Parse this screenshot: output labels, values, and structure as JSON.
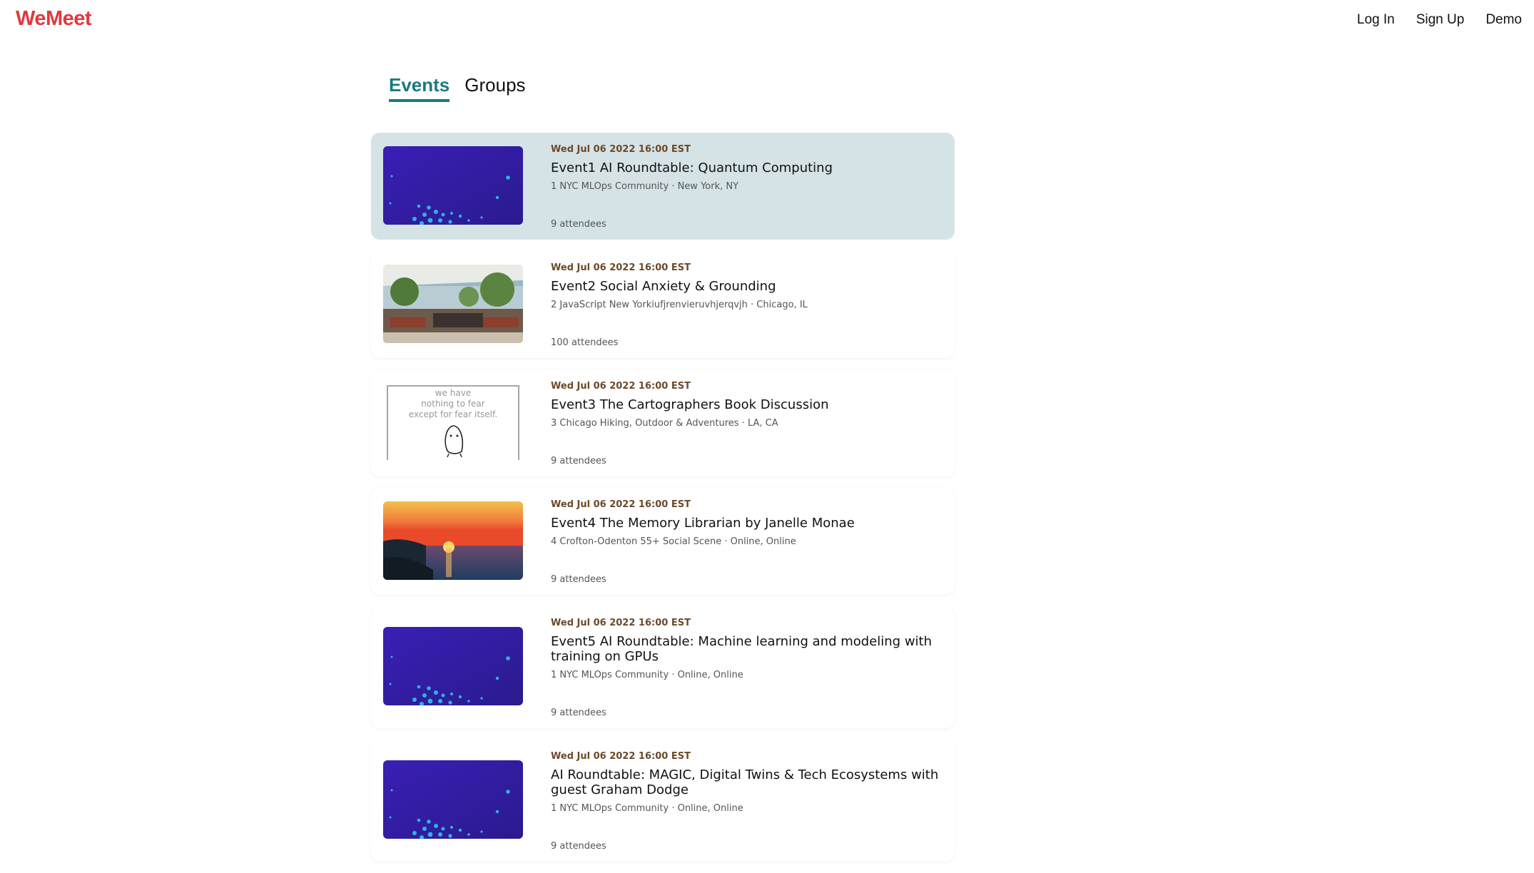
{
  "app": {
    "logo": "WeMeet"
  },
  "nav": {
    "login": "Log In",
    "signup": "Sign Up",
    "demo": "Demo"
  },
  "tabs": [
    {
      "label": "Events",
      "active": true
    },
    {
      "label": "Groups",
      "active": false
    }
  ],
  "colors": {
    "brand": "#e0393e",
    "accent": "#1a7a7f",
    "active_card": "#d6e3e6",
    "date_text": "#6b4a2a"
  },
  "events": [
    {
      "date": "Wed Jul 06 2022 16:00 EST",
      "title": "Event1 AI Roundtable: Quantum Computing",
      "meta": "1 NYC MLOps Community · New York, NY",
      "attendees": "9 attendees",
      "image": "purple-dots",
      "selected": true
    },
    {
      "date": "Wed Jul 06 2022 16:00 EST",
      "title": "Event2 Social Anxiety & Grounding",
      "meta": "2 JavaScript New Yorkiufjrenvieruvhjerqvjh · Chicago, IL",
      "attendees": "100 attendees",
      "image": "rooftop-patio",
      "selected": false
    },
    {
      "date": "Wed Jul 06 2022 16:00 EST",
      "title": "Event3 The Cartographers Book Discussion",
      "meta": "3 Chicago Hiking, Outdoor & Adventures · LA, CA",
      "attendees": "9 attendees",
      "image": "sketch-quote",
      "image_text": [
        "we have",
        "nothing to fear",
        "except for fear itself."
      ],
      "selected": false
    },
    {
      "date": "Wed Jul 06 2022 16:00 EST",
      "title": "Event4 The Memory Librarian by Janelle Monae",
      "meta": "4 Crofton-Odenton 55+ Social Scene · Online, Online",
      "attendees": "9 attendees",
      "image": "sunset-sea",
      "selected": false
    },
    {
      "date": "Wed Jul 06 2022 16:00 EST",
      "title": "Event5 AI Roundtable: Machine learning and modeling with training on GPUs",
      "meta": "1 NYC MLOps Community · Online, Online",
      "attendees": "9 attendees",
      "image": "purple-dots",
      "selected": false
    },
    {
      "date": "Wed Jul 06 2022 16:00 EST",
      "title": "AI Roundtable: MAGIC, Digital Twins & Tech Ecosystems with guest Graham Dodge",
      "meta": "1 NYC MLOps Community · Online, Online",
      "attendees": "9 attendees",
      "image": "purple-dots",
      "selected": false
    }
  ]
}
